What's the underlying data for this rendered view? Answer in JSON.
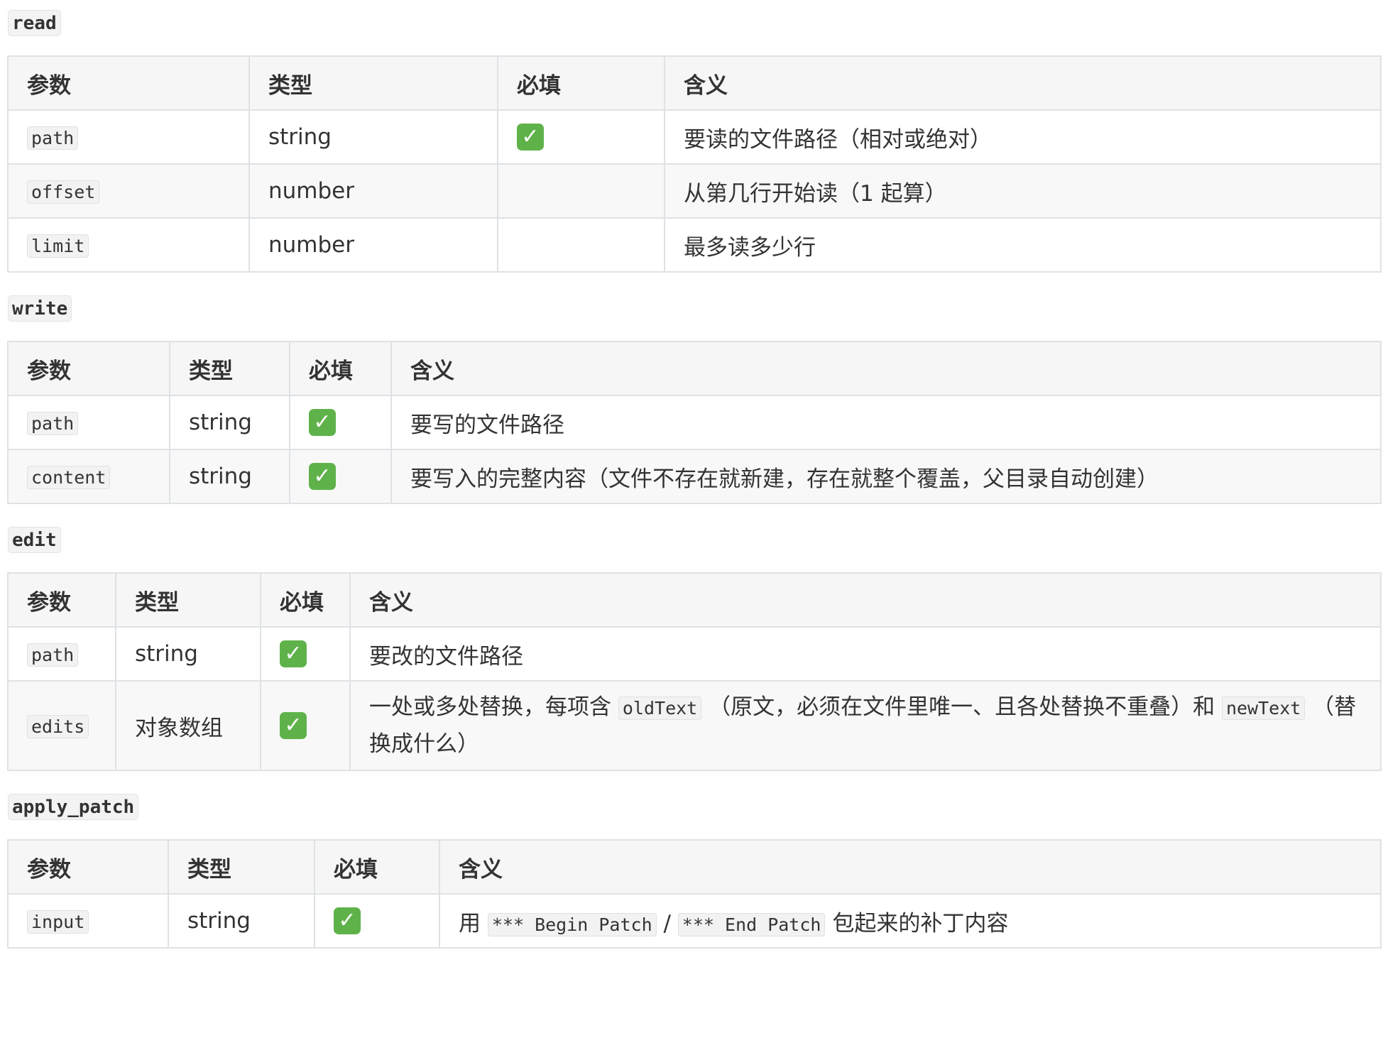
{
  "headers": {
    "param": "参数",
    "type": "类型",
    "required": "必填",
    "meaning": "含义"
  },
  "check_icon": {
    "glyph": "✓",
    "color": "#5fb24a"
  },
  "read": {
    "title": "read",
    "rows": [
      {
        "param": "path",
        "type": "string",
        "required": true,
        "desc": "要读的文件路径（相对或绝对）"
      },
      {
        "param": "offset",
        "type": "number",
        "required": false,
        "desc": "从第几行开始读（1 起算）"
      },
      {
        "param": "limit",
        "type": "number",
        "required": false,
        "desc": "最多读多少行"
      }
    ]
  },
  "write": {
    "title": "write",
    "rows": [
      {
        "param": "path",
        "type": "string",
        "required": true,
        "desc": "要写的文件路径"
      },
      {
        "param": "content",
        "type": "string",
        "required": true,
        "desc": "要写入的完整内容（文件不存在就新建，存在就整个覆盖，父目录自动创建）"
      }
    ]
  },
  "edit": {
    "title": "edit",
    "rows": [
      {
        "param": "path",
        "type": "string",
        "required": true,
        "desc": "要改的文件路径"
      },
      {
        "param": "edits",
        "type": "对象数组",
        "required": true,
        "desc_parts": {
          "a": "一处或多处替换，每项含 ",
          "code1": "oldText",
          "b": " （原文，必须在文件里唯一、且各处替换不重叠）和 ",
          "code2": "newText",
          "c": " （替换成什么）"
        }
      }
    ]
  },
  "apply_patch": {
    "title": "apply_patch",
    "rows": [
      {
        "param": "input",
        "type": "string",
        "required": true,
        "desc_parts": {
          "a": "用 ",
          "code1": "*** Begin Patch",
          "b": " / ",
          "code2": "*** End Patch",
          "c": " 包起来的补丁内容"
        }
      }
    ]
  }
}
